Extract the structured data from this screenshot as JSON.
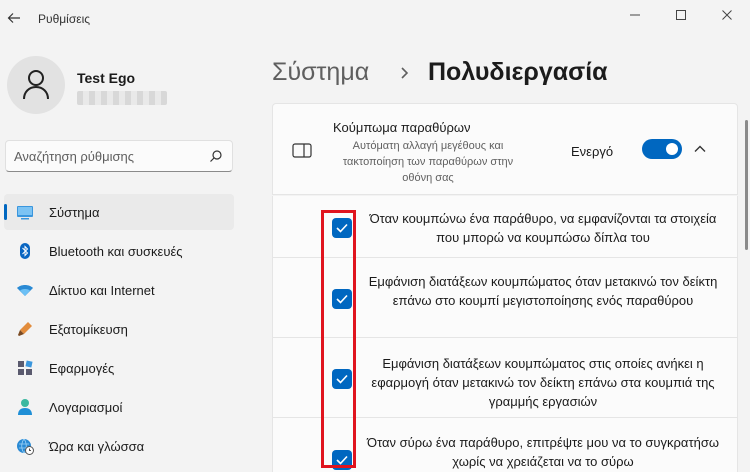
{
  "app": {
    "title": "Ρυθμίσεις"
  },
  "user": {
    "name": "Test Ego"
  },
  "search": {
    "placeholder": "Αναζήτηση ρύθμισης"
  },
  "nav": {
    "items": [
      {
        "label": "Σύστημα",
        "icon": "system-icon"
      },
      {
        "label": "Bluetooth και συσκευές",
        "icon": "bluetooth-icon"
      },
      {
        "label": "Δίκτυο και Internet",
        "icon": "network-icon"
      },
      {
        "label": "Εξατομίκευση",
        "icon": "personalization-icon"
      },
      {
        "label": "Εφαρμογές",
        "icon": "apps-icon"
      },
      {
        "label": "Λογαριασμοί",
        "icon": "accounts-icon"
      },
      {
        "label": "Ώρα και γλώσσα",
        "icon": "time-language-icon"
      }
    ]
  },
  "breadcrumb": {
    "parent": "Σύστημα",
    "separator": "›",
    "current": "Πολυδιεργασία"
  },
  "snap": {
    "title": "Κούμπωμα παραθύρων",
    "description": "Αυτόματη αλλαγή μεγέθους και τακτοποίηση των παραθύρων στην οθόνη σας",
    "state": "Ενεργό",
    "options": [
      {
        "text": "Όταν κουμπώνω ένα παράθυρο, να εμφανίζονται τα στοιχεία που μπορώ να κουμπώσω δίπλα του"
      },
      {
        "text": "Εμφάνιση διατάξεων κουμπώματος όταν μετακινώ τον δείκτη επάνω στο κουμπί μεγιστοποίησης ενός παραθύρου"
      },
      {
        "text": "Εμφάνιση διατάξεων κουμπώματος στις οποίες ανήκει η εφαρμογή όταν μετακινώ τον δείκτη επάνω στα κουμπιά της γραμμής εργασιών"
      },
      {
        "text": "Όταν σύρω ένα παράθυρο, επιτρέψτε μου να το συγκρατήσω χωρίς να χρειάζεται να το σύρω"
      }
    ]
  },
  "colors": {
    "accent": "#0067c0",
    "highlight": "#e0141e",
    "background": "#f3f3f3"
  }
}
